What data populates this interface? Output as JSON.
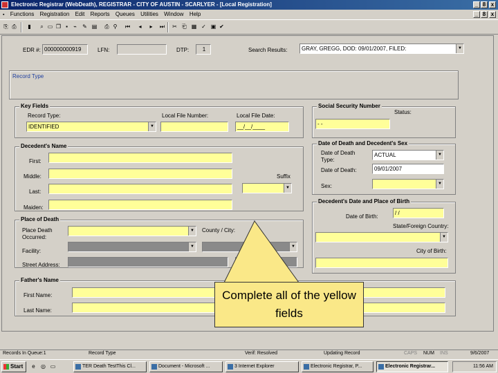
{
  "window": {
    "title": "Electronic Registrar (WebDeath), REGISTRAR - CITY OF AUSTIN - SCARLYER - [Local Registration]",
    "controls": [
      "_",
      "8",
      "x"
    ]
  },
  "menu": [
    "Functions",
    "Registration",
    "Edit",
    "Reports",
    "Queues",
    "Utilities",
    "Window",
    "Help"
  ],
  "header": {
    "edr_label": "EDR #:",
    "edr_value": "000000000919",
    "lfn_label": "LFN:",
    "lfn_value": "",
    "dtp_label": "DTP:",
    "dtp_value": "1",
    "search_label": "Search Results:",
    "search_value": "GRAY, GREGG, DOD: 09/01/2007, FILED:"
  },
  "record_type": {
    "label": "Record Type"
  },
  "key_fields": {
    "title": "Key Fields",
    "record_type_label": "Record Type:",
    "record_type_value": "IDENTIFIED",
    "local_file_number_label": "Local File Number:",
    "local_file_date_label": "Local File Date:",
    "local_file_date_value": "__/__/____"
  },
  "ssn": {
    "title": "Social Security Number",
    "status_label": "Status:",
    "value": "- -"
  },
  "decedent_name": {
    "title": "Decedent's Name",
    "first": "First:",
    "middle": "Middle:",
    "last": "Last:",
    "maiden": "Maiden:",
    "suffix": "Suffix"
  },
  "date_of_death": {
    "title": "Date of Death and Decedent's Sex",
    "dod_type_label": "Date of Death Type:",
    "dod_type_value": "ACTUAL",
    "dod_label": "Date of Death:",
    "dod_value": "09/01/2007",
    "sex_label": "Sex:"
  },
  "birth": {
    "title": "Decedent's Date and Place of Birth",
    "dob_label": "Date of Birth:",
    "dob_value": "/ /",
    "state_label": "State/Foreign Country:",
    "city_label": "City of Birth:"
  },
  "place_of_death": {
    "title": "Place of Death",
    "place_label": "Place Death Occurred:",
    "county_label": "County / City:",
    "facility_label": "Facility:",
    "street_label": "Street Address:"
  },
  "father": {
    "title": "Father's Name",
    "first": "First Name:",
    "last": "Last Name:"
  },
  "callout": {
    "text": "Complete all of the yellow fields"
  },
  "statusbar": {
    "queue": "Records In Queue:1",
    "record_type": "Record Type",
    "verify": "Verif: Resolved",
    "updating": "Updating Record",
    "caps": "CAPS",
    "num": "NUM",
    "ins": "INS",
    "date": "9/6/2007"
  },
  "taskbar": {
    "start": "Start",
    "tasks": [
      "TER Death TestThis Cl...",
      "Document - Microsoft ...",
      "3 Internet Explorer",
      "Electronic Registrar, P...",
      "Electronic Registrar..."
    ],
    "time": "11:56 AM"
  }
}
